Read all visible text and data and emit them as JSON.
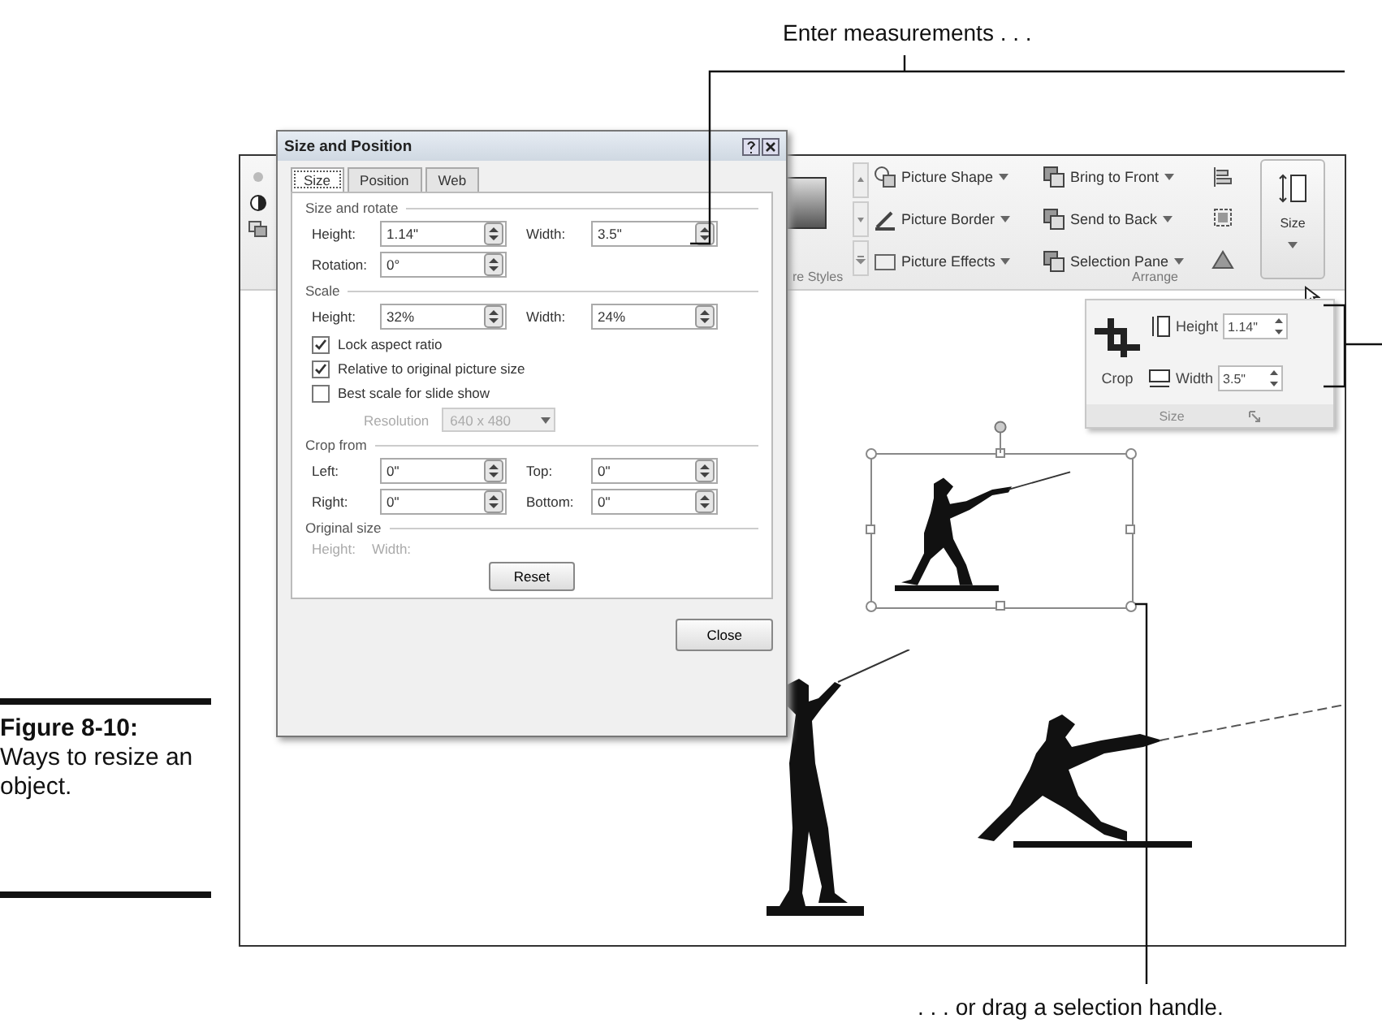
{
  "callouts": [
    {
      "text": "Enter measurements . . ."
    },
    {
      "text": ". . . or drag a selection handle."
    }
  ],
  "figure_caption": {
    "label": "Figure 8-10:",
    "text": "Ways to resize an object."
  },
  "ribbon": {
    "picture_styles": {
      "buttons": [
        "Picture Shape",
        "Picture Border",
        "Picture Effects"
      ],
      "group_label": "re Styles"
    },
    "arrange": {
      "buttons": [
        "Bring to Front",
        "Send to Back",
        "Selection Pane"
      ],
      "group_label": "Arrange"
    },
    "size_button": "Size"
  },
  "size_panel": {
    "crop": "Crop",
    "fields": [
      {
        "label": "Height",
        "value": "1.14\""
      },
      {
        "label": "Width",
        "value": "3.5\""
      }
    ],
    "group_label": "Size"
  },
  "dialog": {
    "title": "Size and Position",
    "tabs": [
      {
        "label": "Size",
        "selected": true
      },
      {
        "label": "Position",
        "selected": false
      },
      {
        "label": "Web",
        "selected": false
      }
    ],
    "sections": [
      {
        "heading": "Size and rotate",
        "items": [
          {
            "kind": "spinners",
            "fields": [
              {
                "label": "Height:",
                "value": "1.14\""
              },
              {
                "label": "Width:",
                "value": "3.5\""
              }
            ]
          },
          {
            "kind": "spinners",
            "fields": [
              {
                "label": "Rotation:",
                "value": "0°"
              }
            ]
          }
        ]
      },
      {
        "heading": "Scale",
        "items": [
          {
            "kind": "spinners",
            "fields": [
              {
                "label": "Height:",
                "value": "32%"
              },
              {
                "label": "Width:",
                "value": "24%"
              }
            ]
          },
          {
            "kind": "checkbox",
            "label": "Lock aspect ratio",
            "checked": true
          },
          {
            "kind": "checkbox",
            "label": "Relative to original picture size",
            "checked": true
          },
          {
            "kind": "checkbox",
            "label": "Best scale for slide show",
            "checked": false
          },
          {
            "kind": "dropdown",
            "label": "Resolution",
            "value": "640 x 480",
            "disabled": true
          }
        ]
      },
      {
        "heading": "Crop from",
        "items": [
          {
            "kind": "spinners",
            "fields": [
              {
                "label": "Left:",
                "value": "0\""
              },
              {
                "label": "Top:",
                "value": "0\""
              }
            ]
          },
          {
            "kind": "spinners",
            "fields": [
              {
                "label": "Right:",
                "value": "0\""
              },
              {
                "label": "Bottom:",
                "value": "0\""
              }
            ]
          }
        ]
      },
      {
        "heading": "Original size",
        "items": [
          {
            "kind": "info",
            "labels": [
              "Height:",
              "Width:"
            ]
          },
          {
            "kind": "button",
            "label": "Reset"
          }
        ]
      }
    ],
    "footer_button": "Close"
  }
}
